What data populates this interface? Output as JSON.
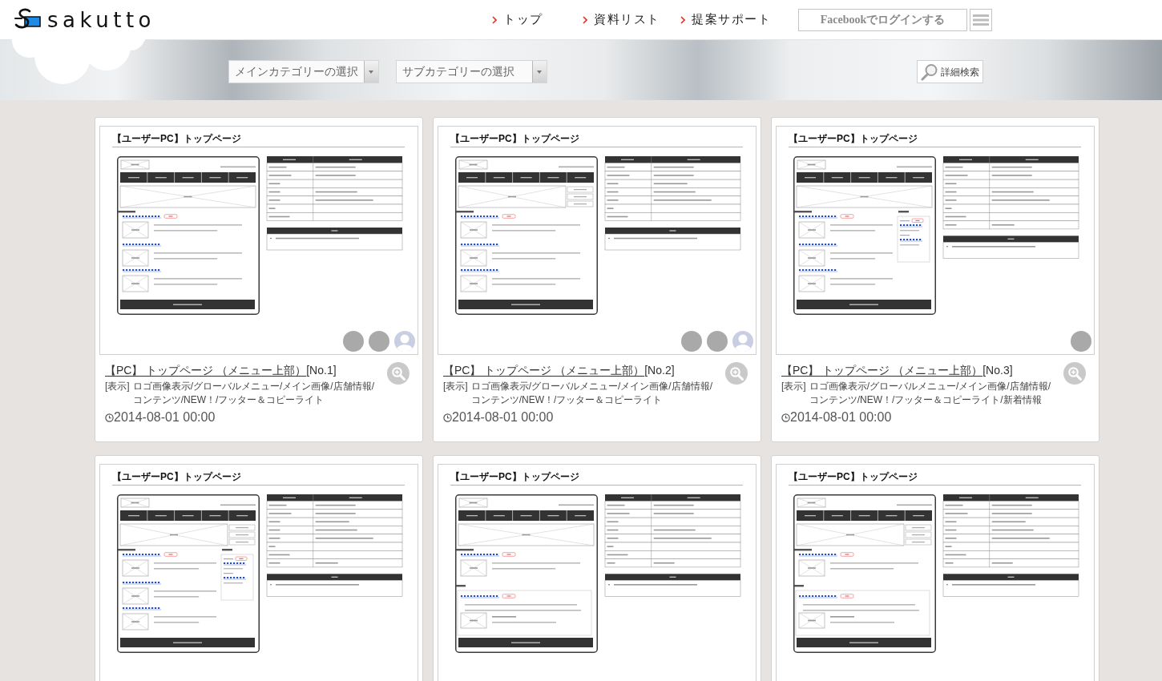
{
  "header": {
    "logo": {
      "text": "sakutto"
    },
    "nav": [
      {
        "label": "トップ"
      },
      {
        "label": "資料リスト"
      },
      {
        "label": "提案サポート"
      }
    ],
    "login_button": "Facebookでログインする"
  },
  "filters": {
    "main_category": {
      "placeholder": "メインカテゴリーの選択"
    },
    "sub_category": {
      "placeholder": "サブカテゴリーの選択"
    },
    "search_button": "詳細検索"
  },
  "cards": [
    {
      "thumbnail": {
        "title": "【ユーザーPC】トップページ",
        "slide_thumbnails": false,
        "news_column": false,
        "blog_section": false,
        "avatars": [
          {
            "kind": "photo"
          },
          {
            "kind": "photo"
          },
          {
            "kind": "silhouette"
          }
        ]
      },
      "title": "【PC】 トップページ （メニュー上部）",
      "number": "[No.1]",
      "display_label": "[表示]",
      "display_items": "ロゴ画像表示/グローバルメニュー/メイン画像/店舗情報/コンテンツ/NEW！/フッター＆コピーライト",
      "date": "2014-08-01 00:00"
    },
    {
      "thumbnail": {
        "title": "【ユーザーPC】トップページ",
        "slide_thumbnails": true,
        "news_column": false,
        "blog_section": false,
        "avatars": [
          {
            "kind": "photo"
          },
          {
            "kind": "photo"
          },
          {
            "kind": "silhouette"
          }
        ]
      },
      "title": "【PC】 トップページ （メニュー上部）",
      "number": "[No.2]",
      "display_label": "[表示]",
      "display_items": "ロゴ画像表示/グローバルメニュー/メイン画像/店舗情報/コンテンツ/NEW！/フッター＆コピーライト",
      "date": "2014-08-01 00:00"
    },
    {
      "thumbnail": {
        "title": "【ユーザーPC】トップページ",
        "slide_thumbnails": false,
        "news_column": true,
        "blog_section": false,
        "avatars": [
          {
            "kind": "photo"
          }
        ]
      },
      "title": "【PC】 トップページ （メニュー上部）",
      "number": "[No.3]",
      "display_label": "[表示]",
      "display_items": "ロゴ画像表示/グローバルメニュー/メイン画像/店舗情報/コンテンツ/NEW！/フッター＆コピーライト/新着情報",
      "date": "2014-08-01 00:00"
    },
    {
      "thumbnail": {
        "title": "【ユーザーPC】トップページ",
        "slide_thumbnails": true,
        "news_column": true,
        "blog_section": false
      }
    },
    {
      "thumbnail": {
        "title": "【ユーザーPC】トップページ",
        "slide_thumbnails": false,
        "news_column": false,
        "blog_section": true
      }
    },
    {
      "thumbnail": {
        "title": "【ユーザーPC】トップページ",
        "slide_thumbnails": true,
        "news_column": false,
        "blog_section": true
      }
    }
  ]
}
